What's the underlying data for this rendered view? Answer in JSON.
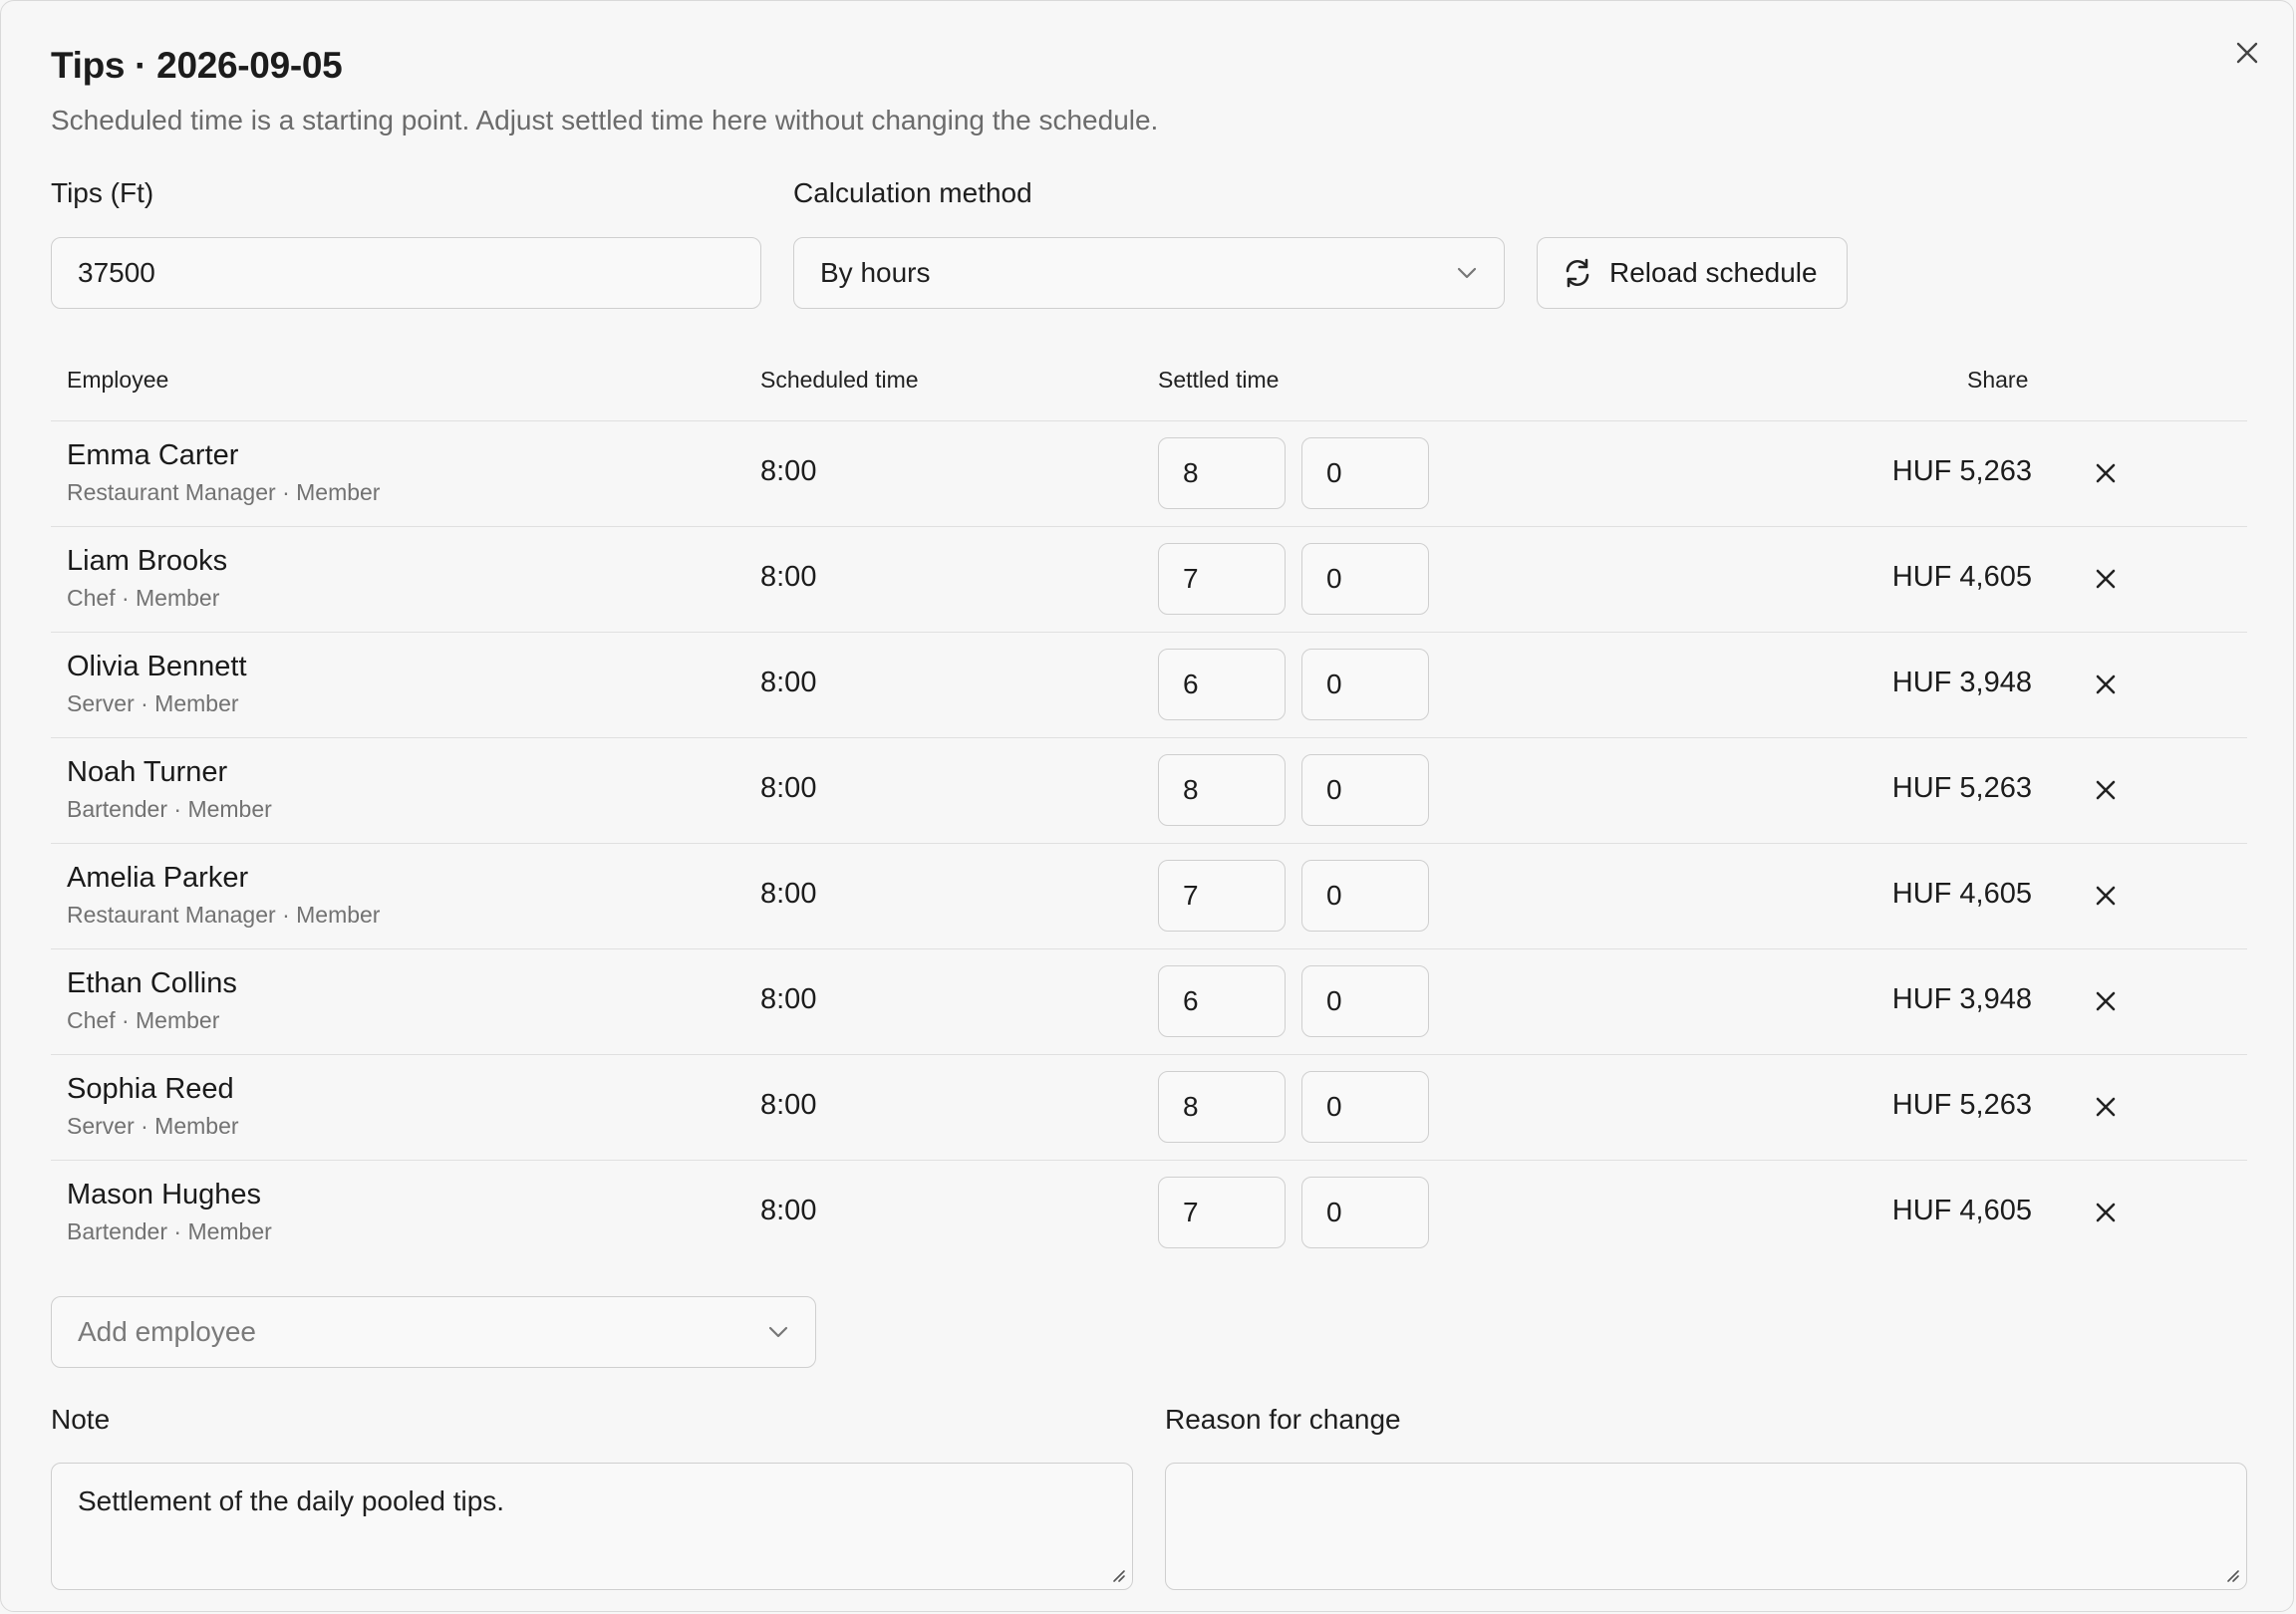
{
  "dialog": {
    "title": "Tips · 2026-09-05",
    "subtitle": "Scheduled time is a starting point. Adjust settled time here without changing the schedule.",
    "close_icon": "close-icon"
  },
  "form": {
    "tips_label": "Tips (Ft)",
    "tips_value": "37500",
    "method_label": "Calculation method",
    "method_value": "By hours",
    "reload_label": "Reload schedule"
  },
  "table": {
    "headers": {
      "employee": "Employee",
      "scheduled": "Scheduled time",
      "settled": "Settled time",
      "share": "Share"
    },
    "rows": [
      {
        "name": "Emma Carter",
        "role": "Restaurant Manager · Member",
        "scheduled": "8:00",
        "hours": "8",
        "minutes": "0",
        "share": "HUF 5,263"
      },
      {
        "name": "Liam Brooks",
        "role": "Chef · Member",
        "scheduled": "8:00",
        "hours": "7",
        "minutes": "0",
        "share": "HUF 4,605"
      },
      {
        "name": "Olivia Bennett",
        "role": "Server · Member",
        "scheduled": "8:00",
        "hours": "6",
        "minutes": "0",
        "share": "HUF 3,948"
      },
      {
        "name": "Noah Turner",
        "role": "Bartender · Member",
        "scheduled": "8:00",
        "hours": "8",
        "minutes": "0",
        "share": "HUF 5,263"
      },
      {
        "name": "Amelia Parker",
        "role": "Restaurant Manager · Member",
        "scheduled": "8:00",
        "hours": "7",
        "minutes": "0",
        "share": "HUF 4,605"
      },
      {
        "name": "Ethan Collins",
        "role": "Chef · Member",
        "scheduled": "8:00",
        "hours": "6",
        "minutes": "0",
        "share": "HUF 3,948"
      },
      {
        "name": "Sophia Reed",
        "role": "Server · Member",
        "scheduled": "8:00",
        "hours": "8",
        "minutes": "0",
        "share": "HUF 5,263"
      },
      {
        "name": "Mason Hughes",
        "role": "Bartender · Member",
        "scheduled": "8:00",
        "hours": "7",
        "minutes": "0",
        "share": "HUF 4,605"
      }
    ]
  },
  "add_employee": {
    "placeholder": "Add employee"
  },
  "note": {
    "label": "Note",
    "value": "Settlement of the daily pooled tips."
  },
  "reason": {
    "label": "Reason for change",
    "value": ""
  },
  "colors": {
    "border": "#cfcfcf",
    "muted_text": "#6b6b6b",
    "background": "#f7f7f7"
  }
}
